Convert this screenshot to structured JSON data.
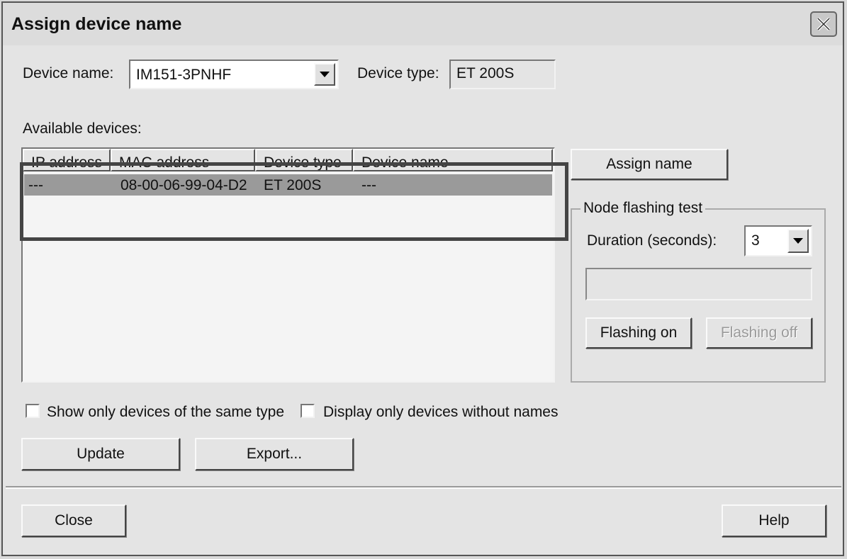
{
  "window": {
    "title": "Assign device name"
  },
  "device_name": {
    "label": "Device name:",
    "value": "IM151-3PNHF"
  },
  "device_type": {
    "label": "Device type:",
    "value": "ET 200S"
  },
  "available_devices": {
    "label": "Available devices:",
    "columns": [
      "IP address",
      "MAC address",
      "Device type",
      "Device name"
    ],
    "rows": [
      {
        "ip": "---",
        "mac": "08-00-06-99-04-D2",
        "type": "ET 200S",
        "name": "---"
      }
    ]
  },
  "assign_button": "Assign name",
  "node_flashing": {
    "title": "Node flashing test",
    "duration_label": "Duration (seconds):",
    "duration_value": "3",
    "flashing_on": "Flashing on",
    "flashing_off": "Flashing off"
  },
  "filters": {
    "same_type": "Show only devices of the same type",
    "without_names": "Display only devices without names"
  },
  "buttons": {
    "update": "Update",
    "export": "Export...",
    "close": "Close",
    "help": "Help"
  },
  "colors": {
    "dialog_bg": "#e4e4e4",
    "selected_row": "#9a9a9a",
    "highlight_frame": "#444444"
  }
}
